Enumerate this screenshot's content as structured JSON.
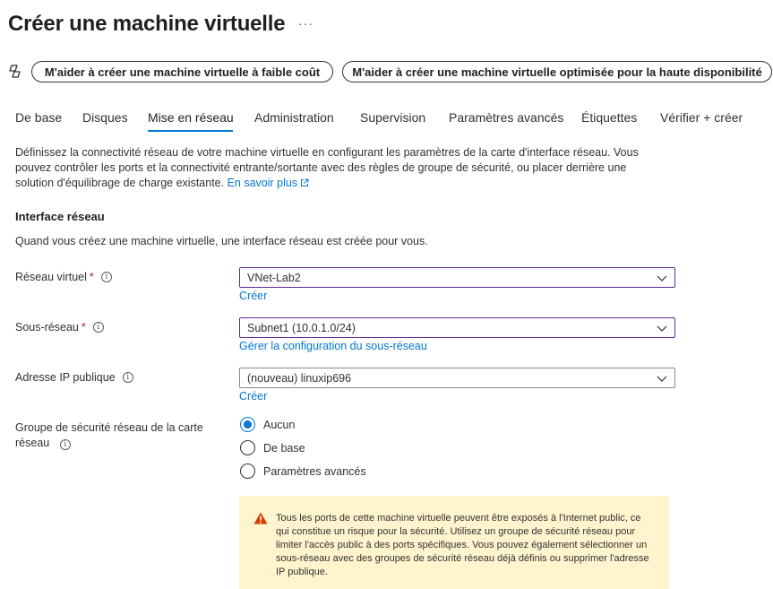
{
  "page": {
    "title": "Créer une machine virtuelle",
    "more": "···"
  },
  "assist": {
    "low_cost": "M'aider à créer une machine virtuelle à faible coût",
    "high_availability": "M'aider à créer une machine virtuelle optimisée pour la haute disponibilité"
  },
  "tabs": [
    {
      "label": "De base"
    },
    {
      "label": "Disques"
    },
    {
      "label": "Mise en réseau"
    },
    {
      "label": "Administration"
    },
    {
      "label": "Supervision"
    },
    {
      "label": "Paramètres avancés"
    },
    {
      "label": "Étiquettes"
    },
    {
      "label": "Vérifier + créer"
    }
  ],
  "active_tab": "Mise en réseau",
  "intro": {
    "text": "Définissez la connectivité réseau de votre machine virtuelle en configurant les paramètres de la carte d'interface réseau. Vous pouvez contrôler les ports et la connectivité entrante/sortante avec des règles de groupe de sécurité, ou placer derrière une solution d'équilibrage de charge existante.",
    "learn_more": "En savoir plus"
  },
  "nic": {
    "heading": "Interface réseau",
    "description": "Quand vous créez une machine virtuelle, une interface réseau est créée pour vous."
  },
  "fields": {
    "vnet": {
      "label": "Réseau virtuel",
      "required": "*",
      "value": "VNet-Lab2",
      "link": "Créer"
    },
    "subnet": {
      "label": "Sous-réseau",
      "required": "*",
      "value": "Subnet1 (10.0.1.0/24)",
      "link": "Gérer la configuration du sous-réseau"
    },
    "public_ip": {
      "label": "Adresse IP publique",
      "value": "(nouveau) linuxip696",
      "link": "Créer"
    }
  },
  "nsg": {
    "label": "Groupe de sécurité réseau de la carte réseau",
    "options": [
      {
        "label": "Aucun",
        "checked": true
      },
      {
        "label": "De base",
        "checked": false
      },
      {
        "label": "Paramètres avancés",
        "checked": false
      }
    ]
  },
  "warning": {
    "text": "Tous les ports de cette machine virtuelle peuvent être exposés à l'Internet public, ce qui constitue un risque pour la sécurité. Utilisez un groupe de sécurité réseau pour limiter l'accès public à des ports spécifiques. Vous pouvez également sélectionner un sous-réseau avec des groupes de sécurité réseau déjà définis ou supprimer l'adresse IP publique."
  },
  "colors": {
    "accent": "#0078d4",
    "focus_border": "#5c2d91",
    "required": "#a4262c",
    "warning_bg": "#fff4ce",
    "warning_icon": "#d83b01"
  }
}
